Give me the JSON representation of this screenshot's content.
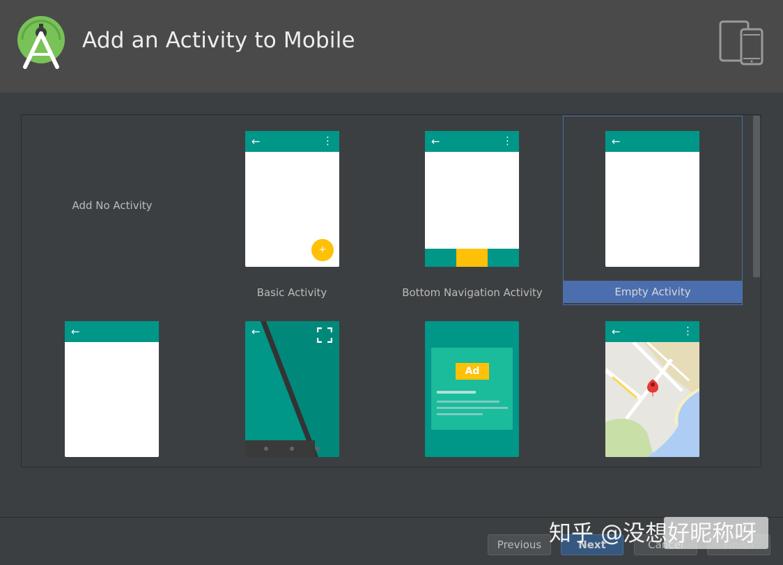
{
  "window": {
    "title": "Add an Activity to Mobile"
  },
  "colors": {
    "toolbar": "#009688",
    "accent": "#ffc107",
    "selection": "#4b6eaf"
  },
  "icons": {
    "logo": "android-studio-logo-icon",
    "device": "phone-tablet-icon"
  },
  "templates": [
    {
      "label": "Add No Activity"
    },
    {
      "label": "Basic Activity"
    },
    {
      "label": "Bottom Navigation Activity"
    },
    {
      "label": "Empty Activity",
      "selected": true
    },
    {
      "label": ""
    },
    {
      "label": ""
    },
    {
      "label": ""
    },
    {
      "label": ""
    }
  ],
  "ad_preview": {
    "badge": "Ad"
  },
  "buttons": {
    "previous": "Previous",
    "next": "Next",
    "cancel": "Cancel",
    "finish": "Finish"
  },
  "watermark": {
    "text": "知乎 @没想好昵称呀"
  }
}
